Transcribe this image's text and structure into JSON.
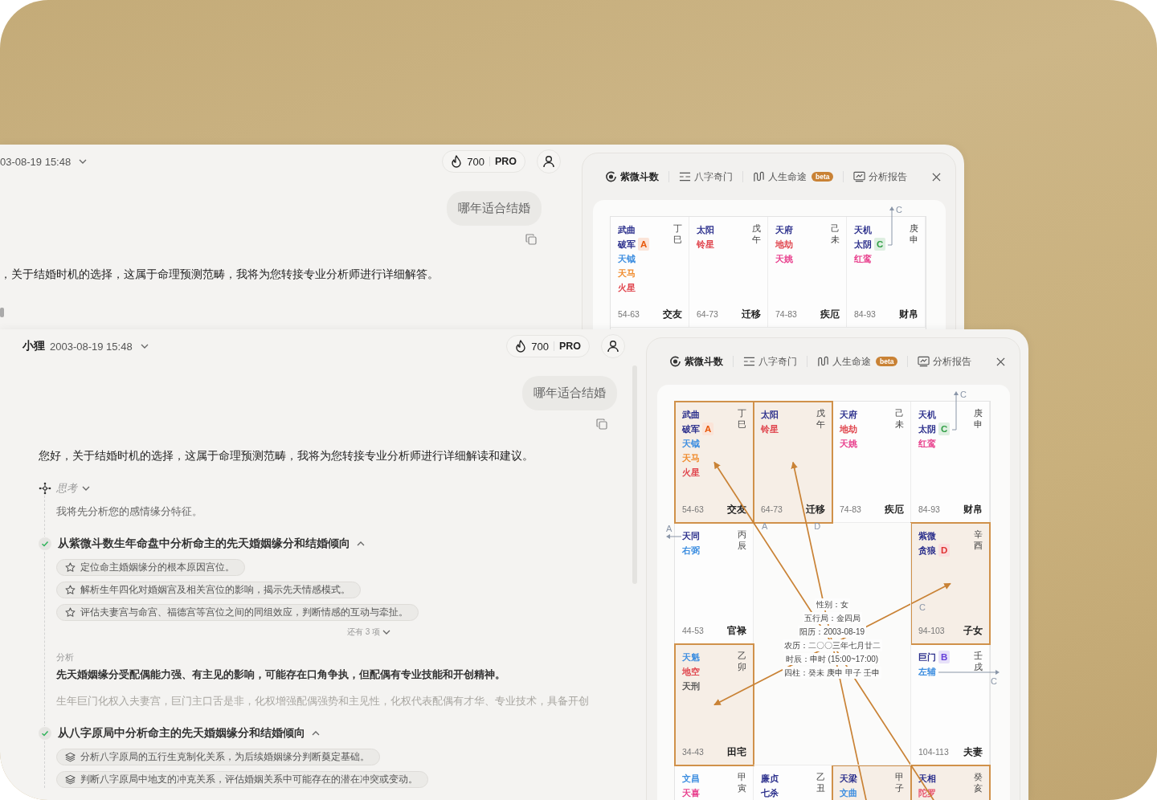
{
  "back_window": {
    "chat": {
      "datetime": "03-08-19 15:48",
      "credits": "700",
      "plan": "PRO",
      "user_message": "哪年适合结婚",
      "reply": "，关于结婚时机的选择，这属于命理预测范畴，我将为您转接专业分析师进行详细解答。"
    },
    "chart": {
      "tabs": [
        {
          "label": "紫微斗数",
          "kind": "ziwei",
          "selected": true
        },
        {
          "label": "八字奇门",
          "kind": "bazi",
          "selected": false
        },
        {
          "label": "人生命途",
          "kind": "life",
          "selected": false,
          "badge": "beta"
        },
        {
          "label": "分析报告",
          "kind": "report",
          "selected": false
        }
      ],
      "palaces": [
        {
          "stem": "丁",
          "branch": "巳",
          "name": "交友",
          "range": "54-63",
          "highlighted": false,
          "stars": [
            {
              "name": "武曲",
              "color": "#2b2f8c"
            },
            {
              "name": "破军",
              "color": "#2b2f8c",
              "mutagen": {
                "letter": "A",
                "color": "#e8590c"
              }
            },
            {
              "name": "天钺",
              "color": "#3d8ee0"
            },
            {
              "name": "天马",
              "color": "#f08c2e"
            },
            {
              "name": "火星",
              "color": "#e0464e"
            }
          ]
        },
        {
          "stem": "戊",
          "branch": "午",
          "name": "迁移",
          "range": "64-73",
          "highlighted": false,
          "stars": [
            {
              "name": "太阳",
              "color": "#2b2f8c"
            },
            {
              "name": "铃星",
              "color": "#e0464e"
            }
          ]
        },
        {
          "stem": "己",
          "branch": "未",
          "name": "疾厄",
          "range": "74-83",
          "highlighted": false,
          "stars": [
            {
              "name": "天府",
              "color": "#2b2f8c"
            },
            {
              "name": "地劫",
              "color": "#e0464e"
            },
            {
              "name": "天姚",
              "color": "#e83e8c"
            }
          ]
        },
        {
          "stem": "庚",
          "branch": "申",
          "name": "财帛",
          "range": "84-93",
          "highlighted": false,
          "stars": [
            {
              "name": "天机",
              "color": "#2b2f8c"
            },
            {
              "name": "太阴",
              "color": "#2b2f8c",
              "mutagen": {
                "letter": "C",
                "color": "#2f9e44"
              },
              "self": "C"
            },
            {
              "name": "红鸾",
              "color": "#e83e8c"
            }
          ]
        }
      ]
    }
  },
  "front_window": {
    "chat": {
      "name": "小狸",
      "datetime": "2003-08-19 15:48",
      "credits": "700",
      "plan": "PRO",
      "user_message": "哪年适合结婚",
      "reply": "您好，关于结婚时机的选择，这属于命理预测范畴，我将为您转接专业分析师进行详细解读和建议。",
      "thinking": {
        "label": "思考",
        "text": "我将先分析您的感情缘分特征。"
      },
      "steps": [
        {
          "kind": "ziwei",
          "done": true,
          "expanded": true,
          "title": "从紫微斗数生年命盘中分析命主的先天婚姻缘分和结婚倾向",
          "items": [
            "定位命主婚姻缘分的根本原因宫位。",
            "解析生年四化对婚姻宫及相关宫位的影响，揭示先天情感模式。",
            "评估夫妻宫与命宫、福德宫等宫位之间的同组效应，判断情感的互动与牵扯。"
          ],
          "more": "还有 3 项",
          "analysis_label": "分析",
          "analysis": "先天婚姻缘分受配偶能力强、有主见的影响，可能存在口角争执，但配偶有专业技能和开创精神。",
          "detail": "生年巨门化权入夫妻宫，巨门主口舌是非，化权增强配偶强势和主见性，化权代表配偶有才华、专业技术，具备开创"
        },
        {
          "kind": "bazi",
          "done": true,
          "expanded": true,
          "title": "从八字原局中分析命主的先天婚姻缘分和结婚倾向",
          "items": [
            "分析八字原局的五行生克制化关系，为后续婚姻缘分判断奠定基础。",
            "判断八字原局中地支的冲克关系，评估婚姻关系中可能存在的潜在冲突或变动。"
          ]
        }
      ]
    },
    "chart": {
      "tabs": [
        {
          "label": "紫微斗数",
          "kind": "ziwei",
          "selected": true
        },
        {
          "label": "八字奇门",
          "kind": "bazi",
          "selected": false
        },
        {
          "label": "人生命途",
          "kind": "life",
          "selected": false,
          "badge": "beta"
        },
        {
          "label": "分析报告",
          "kind": "report",
          "selected": false
        }
      ],
      "palaces": [
        {
          "stem": "丁",
          "branch": "巳",
          "name": "交友",
          "range": "54-63",
          "highlighted": true,
          "stars": [
            {
              "name": "武曲",
              "color": "#2b2f8c"
            },
            {
              "name": "破军",
              "color": "#2b2f8c",
              "mutagen": {
                "letter": "A",
                "color": "#e8590c"
              }
            },
            {
              "name": "天钺",
              "color": "#3d8ee0"
            },
            {
              "name": "天马",
              "color": "#f08c2e"
            },
            {
              "name": "火星",
              "color": "#e0464e"
            }
          ]
        },
        {
          "stem": "戊",
          "branch": "午",
          "name": "迁移",
          "range": "64-73",
          "highlighted": true,
          "stars": [
            {
              "name": "太阳",
              "color": "#2b2f8c"
            },
            {
              "name": "铃星",
              "color": "#e0464e"
            }
          ]
        },
        {
          "stem": "己",
          "branch": "未",
          "name": "疾厄",
          "range": "74-83",
          "highlighted": false,
          "stars": [
            {
              "name": "天府",
              "color": "#2b2f8c"
            },
            {
              "name": "地劫",
              "color": "#e0464e"
            },
            {
              "name": "天姚",
              "color": "#e83e8c"
            }
          ]
        },
        {
          "stem": "庚",
          "branch": "申",
          "name": "财帛",
          "range": "84-93",
          "highlighted": false,
          "stars": [
            {
              "name": "天机",
              "color": "#2b2f8c"
            },
            {
              "name": "太阴",
              "color": "#2b2f8c",
              "mutagen": {
                "letter": "C",
                "color": "#2f9e44"
              },
              "self": "C"
            },
            {
              "name": "红鸾",
              "color": "#e83e8c"
            }
          ]
        },
        {
          "stem": "丙",
          "branch": "辰",
          "name": "官禄",
          "range": "44-53",
          "highlighted": false,
          "stars": [
            {
              "name": "天同",
              "color": "#2b2f8c",
              "self": "A"
            },
            {
              "name": "右弼",
              "color": "#3d8ee0"
            }
          ]
        },
        {
          "stem": "辛",
          "branch": "酉",
          "name": "子女",
          "range": "94-103",
          "highlighted": true,
          "stars": [
            {
              "name": "紫微",
              "color": "#2b2f8c"
            },
            {
              "name": "贪狼",
              "color": "#2b2f8c",
              "mutagen": {
                "letter": "D",
                "color": "#e03131"
              }
            }
          ]
        },
        {
          "stem": "乙",
          "branch": "卯",
          "name": "田宅",
          "range": "34-43",
          "highlighted": true,
          "stars": [
            {
              "name": "天魁",
              "color": "#3d8ee0"
            },
            {
              "name": "地空",
              "color": "#e0464e"
            },
            {
              "name": "天刑",
              "color": "#555555"
            }
          ]
        },
        {
          "stem": "壬",
          "branch": "戌",
          "name": "夫妻",
          "range": "104-113",
          "highlighted": false,
          "stars": [
            {
              "name": "巨门",
              "color": "#2b2f8c",
              "mutagen": {
                "letter": "B",
                "color": "#6741d9"
              }
            },
            {
              "name": "左辅",
              "color": "#3d8ee0",
              "self": "C"
            }
          ]
        },
        {
          "stem": "甲",
          "branch": "寅",
          "highlighted": false,
          "stars": [
            {
              "name": "文昌",
              "color": "#3d8ee0"
            },
            {
              "name": "天喜",
              "color": "#e83e8c"
            }
          ]
        },
        {
          "stem": "乙",
          "branch": "丑",
          "highlighted": false,
          "stars": [
            {
              "name": "廉贞",
              "color": "#2b2f8c"
            },
            {
              "name": "七杀",
              "color": "#2b2f8c"
            }
          ]
        },
        {
          "stem": "甲",
          "branch": "子",
          "highlighted": true,
          "stars": [
            {
              "name": "天梁",
              "color": "#2b2f8c"
            },
            {
              "name": "文曲",
              "color": "#3d8ee0"
            }
          ]
        },
        {
          "stem": "癸",
          "branch": "亥",
          "highlighted": true,
          "stars": [
            {
              "name": "天相",
              "color": "#2b2f8c"
            },
            {
              "name": "陀罗",
              "color": "#e8546e"
            }
          ]
        }
      ],
      "center": [
        "性别：女",
        "五行局：金四局",
        "阳历：2003-08-19",
        "农历：二〇〇三年七月廿二",
        "时辰：申时 (15:00~17:00)",
        "四柱：癸未 庚申 甲子 壬申"
      ],
      "arrows": [
        {
          "label": "A"
        },
        {
          "label": "D"
        },
        {
          "label": "C",
          "two_way": true
        }
      ]
    }
  }
}
